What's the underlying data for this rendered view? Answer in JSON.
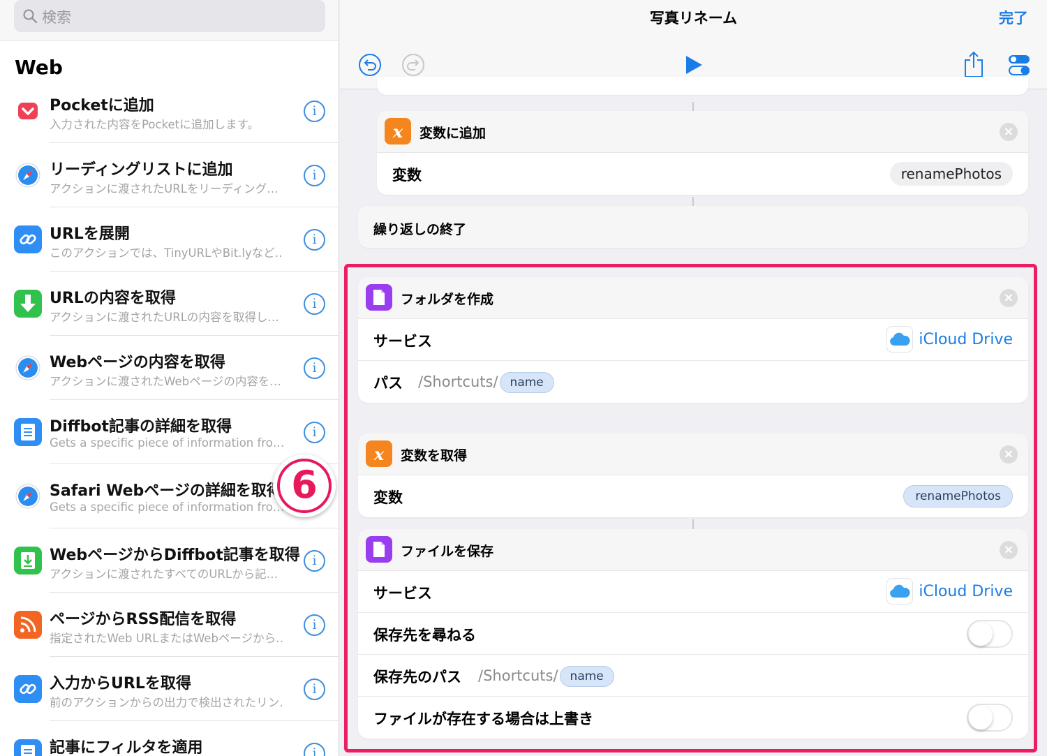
{
  "search": {
    "placeholder": "検索"
  },
  "sidebar": {
    "title": "Web",
    "items": [
      {
        "title": "Pocketに追加",
        "desc": "入力された内容をPocketに追加します。",
        "icon": "pocket-icon",
        "color": "#ffffff"
      },
      {
        "title": "リーディングリストに追加",
        "desc": "アクションに渡されたURLをリーディング…",
        "icon": "safari-icon",
        "color": "#ffffff"
      },
      {
        "title": "URLを展開",
        "desc": "このアクションでは、TinyURLやBit.lyなど…",
        "icon": "link-icon",
        "color": "#2f8ef4"
      },
      {
        "title": "URLの内容を取得",
        "desc": "アクションに渡されたURLの内容を取得し…",
        "icon": "download-icon",
        "color": "#31c24d"
      },
      {
        "title": "Webページの内容を取得",
        "desc": "アクションに渡されたWebページの内容を…",
        "icon": "safari-icon",
        "color": "#ffffff"
      },
      {
        "title": "Diffbot記事の詳細を取得",
        "desc": "Gets a specific piece of information fro…",
        "icon": "article-icon",
        "color": "#2f8ef4"
      },
      {
        "title": "Safari Webページの詳細を取得",
        "desc": "Gets a specific piece of information fro…",
        "icon": "safari-icon",
        "color": "#ffffff"
      },
      {
        "title": "WebページからDiffbot記事を取得",
        "desc": "アクションに渡されたすべてのURLから記…",
        "icon": "article-download-icon",
        "color": "#31c24d"
      },
      {
        "title": "ページからRSS配信を取得",
        "desc": "指定されたWeb URLまたはWebページから…",
        "icon": "rss-icon",
        "color": "#f26522"
      },
      {
        "title": "入力からURLを取得",
        "desc": "前のアクションからの出力で検出されたリン…",
        "icon": "link-icon",
        "color": "#2f8ef4"
      },
      {
        "title": "記事にフィルタを適用",
        "desc": "",
        "icon": "article-icon",
        "color": "#2f8ef4"
      }
    ],
    "step_badge": "6"
  },
  "editor": {
    "title": "写真リネーム",
    "done": "完了",
    "cards": {
      "add_var": {
        "name": "変数に追加",
        "row_label": "変数",
        "row_value": "renamePhotos"
      },
      "end_repeat": {
        "name": "繰り返しの終了"
      },
      "create_folder": {
        "name": "フォルダを作成",
        "service_label": "サービス",
        "service_value": "iCloud Drive",
        "path_label": "パス",
        "path_prefix": "/Shortcuts/",
        "path_var": "name"
      },
      "get_var": {
        "name": "変数を取得",
        "row_label": "変数",
        "row_value": "renamePhotos"
      },
      "save_file": {
        "name": "ファイルを保存",
        "service_label": "サービス",
        "service_value": "iCloud Drive",
        "ask_label": "保存先を尋ねる",
        "path_label": "保存先のパス",
        "path_prefix": "/Shortcuts/",
        "path_var": "name",
        "overwrite_label": "ファイルが存在する場合は上書き"
      }
    },
    "colors": {
      "accent": "#1a7de6",
      "highlight": "#ec1e63",
      "variable_badge": "#f5861f",
      "file_badge": "#9a3cf0"
    }
  }
}
